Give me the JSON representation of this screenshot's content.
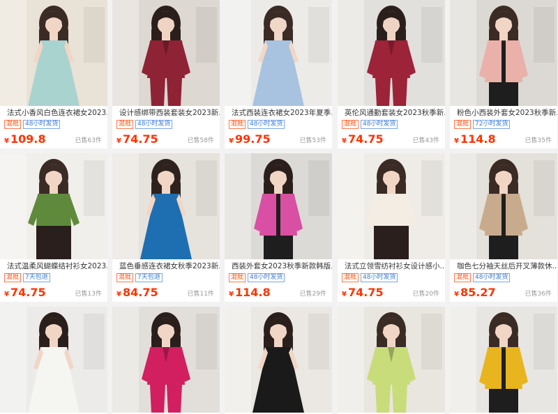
{
  "products": [
    {
      "title": "法式小香风白色连衣裙女2023...",
      "tags": [
        "混批",
        "48小时发货"
      ],
      "currency": "¥",
      "price": "109.8",
      "sold": "已售63件",
      "colors": {
        "bg": "#e9e2d6",
        "garment": "#a9d3cf",
        "skin": "#f1d6c5",
        "hair": "#3a2b25"
      },
      "garment_type": "dress"
    },
    {
      "title": "设计感绑带西装套装女2023新...",
      "tags": [
        "混批",
        "48小时发货"
      ],
      "currency": "¥",
      "price": "74.75",
      "sold": "已售58件",
      "colors": {
        "bg": "#ddd8d1",
        "garment": "#8e2336",
        "skin": "#f0d4c3",
        "hair": "#2b1f1c"
      },
      "garment_type": "suit"
    },
    {
      "title": "法式西装连衣裙女2023年夏季...",
      "tags": [
        "混批",
        "48小时发货"
      ],
      "currency": "¥",
      "price": "99.75",
      "sold": "已售53件",
      "colors": {
        "bg": "#ecebe8",
        "garment": "#a7c3e0",
        "skin": "#f1d7c7",
        "hair": "#3a2b25"
      },
      "garment_type": "dress"
    },
    {
      "title": "英伦风通勤套装女2023秋季新...",
      "tags": [
        "混批",
        "48小时发货"
      ],
      "currency": "¥",
      "price": "74.75",
      "sold": "已售43件",
      "colors": {
        "bg": "#e2e0dc",
        "garment": "#9c2338",
        "skin": "#f0d4c3",
        "hair": "#2b1f1c"
      },
      "garment_type": "suit"
    },
    {
      "title": "粉色小西装外套女2023秋季新...",
      "tags": [
        "混批",
        "72小时发货"
      ],
      "currency": "¥",
      "price": "114.8",
      "sold": "已售35件",
      "colors": {
        "bg": "#dcd9d4",
        "garment": "#eab1aa",
        "skin": "#f1d6c5",
        "hair": "#3a2b25"
      },
      "garment_type": "blazer"
    },
    {
      "title": "法式温柔风蝴蝶结衬衫女2023...",
      "tags": [
        "混批",
        "7天包退"
      ],
      "currency": "¥",
      "price": "74.75",
      "sold": "已售13件",
      "colors": {
        "bg": "#f1efeb",
        "garment": "#5f8a3c",
        "skin": "#f1d6c5",
        "hair": "#3a2b25"
      },
      "garment_type": "blouse"
    },
    {
      "title": "蓝色垂感连衣裙女秋季2023新...",
      "tags": [
        "混批",
        "7天包退"
      ],
      "currency": "¥",
      "price": "84.75",
      "sold": "已售11件",
      "colors": {
        "bg": "#e6e2dc",
        "garment": "#1d6fb2",
        "skin": "#f1d6c5",
        "hair": "#2e221e"
      },
      "garment_type": "dress"
    },
    {
      "title": "西装外套女2023秋季新款韩版...",
      "tags": [
        "混批",
        "48小时发货"
      ],
      "currency": "¥",
      "price": "114.8",
      "sold": "已售29件",
      "colors": {
        "bg": "#dcdad6",
        "garment": "#d94fa3",
        "skin": "#f1d6c5",
        "hair": "#2b1f1c"
      },
      "garment_type": "blazer"
    },
    {
      "title": "法式立领雪纺衬衫女设计感小...",
      "tags": [
        "混批",
        "48小时发货"
      ],
      "currency": "¥",
      "price": "74.75",
      "sold": "已售20件",
      "colors": {
        "bg": "#efece7",
        "garment": "#f3ede4",
        "skin": "#f1d6c5",
        "hair": "#3a2b25"
      },
      "garment_type": "blouse"
    },
    {
      "title": "咖色七分袖天丝后开叉薄款休...",
      "tags": [
        "混批",
        "48小时发货"
      ],
      "currency": "¥",
      "price": "85.27",
      "sold": "已售36件",
      "colors": {
        "bg": "#e4e0da",
        "garment": "#c8ab8c",
        "skin": "#f1d6c5",
        "hair": "#3a2b25"
      },
      "garment_type": "blazer"
    },
    {
      "title": "",
      "tags": [],
      "currency": "",
      "price": "",
      "sold": "",
      "colors": {
        "bg": "#ecebea",
        "garment": "#f5f5f2",
        "skin": "#f1d6c5",
        "hair": "#2b1f1c"
      },
      "garment_type": "dress"
    },
    {
      "title": "",
      "tags": [],
      "currency": "",
      "price": "",
      "sold": "",
      "colors": {
        "bg": "#e2dfda",
        "garment": "#d11f5f",
        "skin": "#f1d6c5",
        "hair": "#2b1f1c"
      },
      "garment_type": "suit"
    },
    {
      "title": "",
      "tags": [],
      "currency": "",
      "price": "",
      "sold": "",
      "colors": {
        "bg": "#ebe8e3",
        "garment": "#1a1a1a",
        "skin": "#f1d6c5",
        "hair": "#2b1f1c"
      },
      "garment_type": "dress"
    },
    {
      "title": "",
      "tags": [],
      "currency": "",
      "price": "",
      "sold": "",
      "colors": {
        "bg": "#e9e6e0",
        "garment": "#c9dc7a",
        "skin": "#f1d6c5",
        "hair": "#3a2b25"
      },
      "garment_type": "suit"
    },
    {
      "title": "",
      "tags": [],
      "currency": "",
      "price": "",
      "sold": "",
      "colors": {
        "bg": "#e8e6e2",
        "garment": "#e8b51e",
        "skin": "#f1d6c5",
        "hair": "#3a2b25"
      },
      "garment_type": "blazer"
    }
  ]
}
